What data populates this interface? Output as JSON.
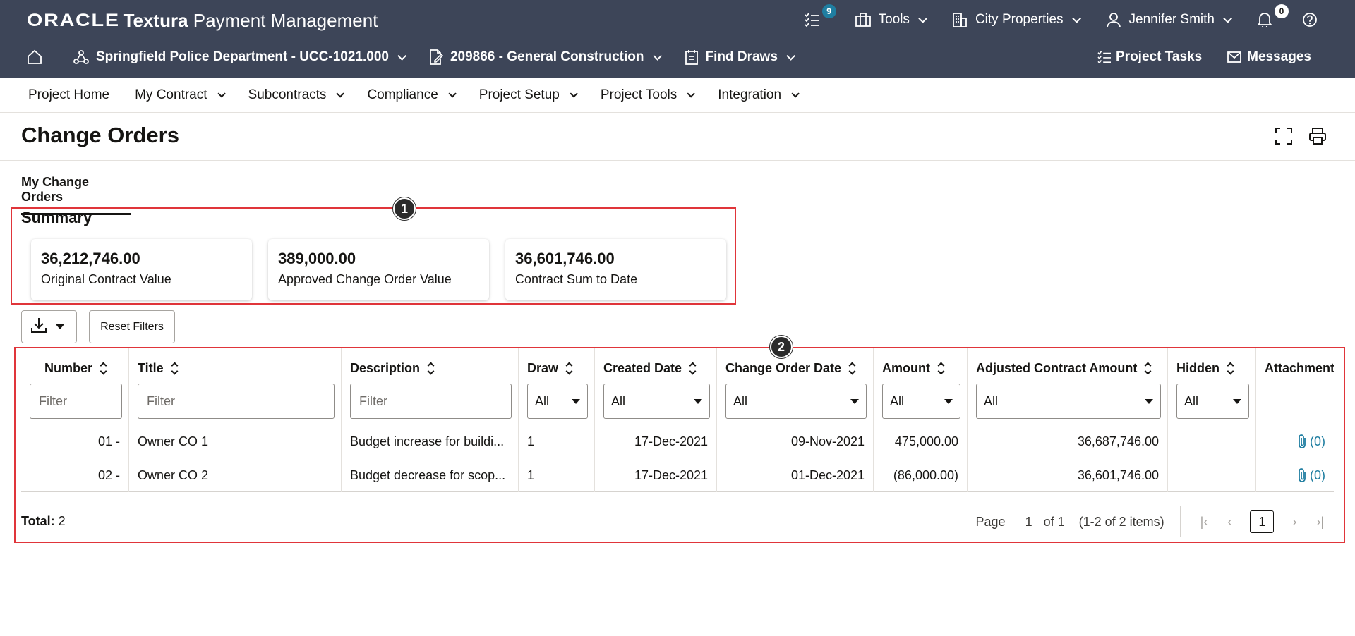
{
  "banner": {
    "logo": "ORACLE",
    "product_bold": "Textura",
    "product_rest": " Payment Management",
    "tasks_badge": "9",
    "tools_label": "Tools",
    "org_label": "City Properties",
    "user_label": "Jennifer Smith",
    "notifications_badge": "0"
  },
  "subbar": {
    "project_label": "Springfield Police Department - UCC-1021.000",
    "contract_label": "209866 - General Construction",
    "draws_label": "Find Draws",
    "project_tasks_label": "Project Tasks",
    "messages_label": "Messages"
  },
  "nav": {
    "items": [
      {
        "label": "Project Home"
      },
      {
        "label": "My Contract"
      },
      {
        "label": "Subcontracts"
      },
      {
        "label": "Compliance"
      },
      {
        "label": "Project Setup"
      },
      {
        "label": "Project Tools"
      },
      {
        "label": "Integration"
      }
    ]
  },
  "page": {
    "title": "Change Orders",
    "tab": "My Change Orders"
  },
  "summary": {
    "title": "Summary",
    "marker": "1",
    "cards": [
      {
        "value": "36,212,746.00",
        "label": "Original Contract Value"
      },
      {
        "value": "389,000.00",
        "label": "Approved Change Order Value"
      },
      {
        "value": "36,601,746.00",
        "label": "Contract Sum to Date"
      }
    ]
  },
  "toolbar": {
    "reset_label": "Reset Filters"
  },
  "table": {
    "marker": "2",
    "columns": [
      {
        "label": "Number",
        "filter": "Filter"
      },
      {
        "label": "Title",
        "filter": "Filter"
      },
      {
        "label": "Description",
        "filter": "Filter"
      },
      {
        "label": "Draw",
        "filter": "All"
      },
      {
        "label": "Created Date",
        "filter": "All"
      },
      {
        "label": "Change Order Date",
        "filter": "All"
      },
      {
        "label": "Amount",
        "filter": "All"
      },
      {
        "label": "Adjusted Contract Amount",
        "filter": "All"
      },
      {
        "label": "Hidden",
        "filter": "All"
      },
      {
        "label": "Attachments"
      }
    ],
    "rows": [
      {
        "number": "01 -",
        "title": "Owner CO 1",
        "description": "Budget increase for buildi...",
        "draw": "1",
        "created": "17-Dec-2021",
        "co_date": "09-Nov-2021",
        "amount": "475,000.00",
        "adjusted": "36,687,746.00",
        "hidden": "",
        "attachments": "(0)"
      },
      {
        "number": "02 -",
        "title": "Owner CO 2",
        "description": "Budget decrease for scop...",
        "draw": "1",
        "created": "17-Dec-2021",
        "co_date": "01-Dec-2021",
        "amount": "(86,000.00)",
        "adjusted": "36,601,746.00",
        "hidden": "",
        "attachments": "(0)"
      }
    ],
    "total_label": "Total:",
    "total_value": "2",
    "pager": {
      "page_label": "Page",
      "page_value": "1",
      "of_label": "of 1",
      "range_label": "(1-2 of 2 items)",
      "current": "1"
    }
  }
}
